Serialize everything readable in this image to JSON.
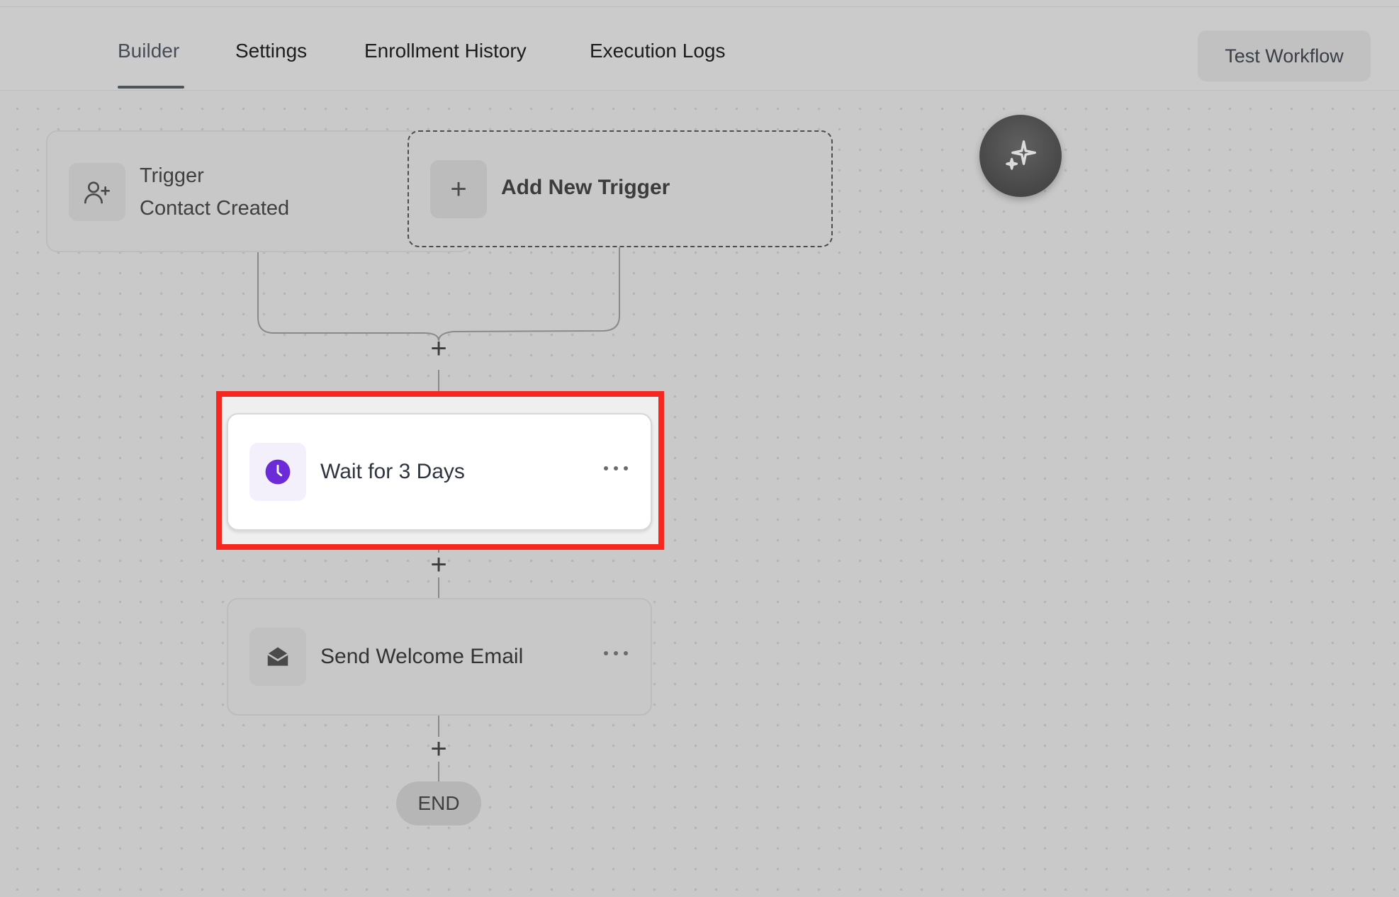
{
  "tabs": [
    {
      "label": "Builder",
      "active": true
    },
    {
      "label": "Settings",
      "active": false
    },
    {
      "label": "Enrollment History",
      "active": false
    },
    {
      "label": "Execution Logs",
      "active": false
    }
  ],
  "header": {
    "test_button_label": "Test Workflow"
  },
  "trigger": {
    "title": "Trigger",
    "subtitle": "Contact Created",
    "icon": "user-plus-icon"
  },
  "add_trigger": {
    "label": "Add New Trigger",
    "icon": "plus-icon"
  },
  "ai_assistant": {
    "icon": "sparkles-icon"
  },
  "steps": [
    {
      "label": "Wait for 3 Days",
      "icon": "clock-icon",
      "icon_color": "#6b2bd9",
      "selected": true
    },
    {
      "label": "Send Welcome Email",
      "icon": "envelope-open-icon",
      "icon_color": "#4a4a4a",
      "selected": false
    }
  ],
  "add_step_label": "+",
  "end_label": "END",
  "colors": {
    "selection_outline": "#f5271e",
    "canvas_background": "#c9c9c9",
    "wait_icon": "#6b2bd9"
  }
}
